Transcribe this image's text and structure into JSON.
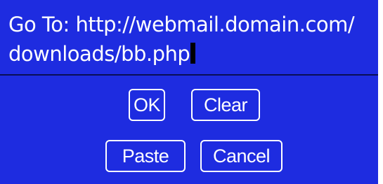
{
  "goto": {
    "label": "Go To:",
    "url_line1": "http://webmail.domain.com/",
    "url_line2": "downloads/bb.php"
  },
  "buttons": {
    "ok": "OK",
    "clear": "Clear",
    "paste": "Paste",
    "cancel": "Cancel"
  },
  "colors": {
    "background": "#1e2ce0",
    "text": "#ffffff",
    "cursor": "#000000"
  }
}
